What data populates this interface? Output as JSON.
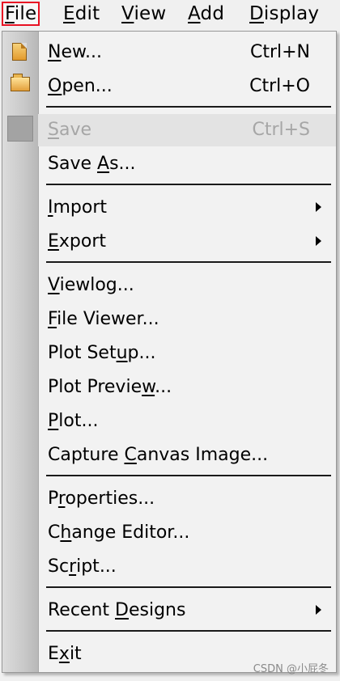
{
  "menubar": {
    "items": [
      {
        "mn": "F",
        "rest": "ile"
      },
      {
        "mn": "E",
        "rest": "dit"
      },
      {
        "mn": "V",
        "rest": "iew"
      },
      {
        "mn": "A",
        "rest": "dd"
      },
      {
        "mn": "D",
        "rest": "isplay"
      }
    ]
  },
  "file_menu": {
    "new": {
      "pre": "",
      "mn": "N",
      "post": "ew...",
      "shortcut": "Ctrl+N"
    },
    "open": {
      "pre": "",
      "mn": "O",
      "post": "pen...",
      "shortcut": "Ctrl+O"
    },
    "save": {
      "pre": "",
      "mn": "S",
      "post": "ave",
      "shortcut": "Ctrl+S"
    },
    "save_as": {
      "pre": "Save ",
      "mn": "A",
      "post": "s..."
    },
    "import": {
      "pre": "",
      "mn": "I",
      "post": "mport"
    },
    "export": {
      "pre": "",
      "mn": "E",
      "post": "xport"
    },
    "viewlog": {
      "pre": "",
      "mn": "V",
      "post": "iewlog..."
    },
    "file_viewer": {
      "pre": "",
      "mn": "F",
      "post": "ile Viewer..."
    },
    "plot_setup": {
      "pre": "Plot Set",
      "mn": "u",
      "post": "p..."
    },
    "plot_preview": {
      "pre": "Plot Previe",
      "mn": "w",
      "post": "..."
    },
    "plot": {
      "pre": "",
      "mn": "P",
      "post": "lot..."
    },
    "capture_canvas": {
      "pre": "Capture ",
      "mn": "C",
      "post": "anvas Image..."
    },
    "properties": {
      "pre": "P",
      "mn": "r",
      "post": "operties..."
    },
    "change_editor": {
      "pre": "C",
      "mn": "h",
      "post": "ange Editor..."
    },
    "script": {
      "pre": "Sc",
      "mn": "r",
      "post": "ipt..."
    },
    "recent_designs": {
      "pre": "Recent ",
      "mn": "D",
      "post": "esigns"
    },
    "exit": {
      "pre": "E",
      "mn": "x",
      "post": "it"
    }
  },
  "watermark": "CSDN @小屁冬",
  "colors": {
    "active_border": "#e81123",
    "disabled_text": "#a6a6a6"
  }
}
